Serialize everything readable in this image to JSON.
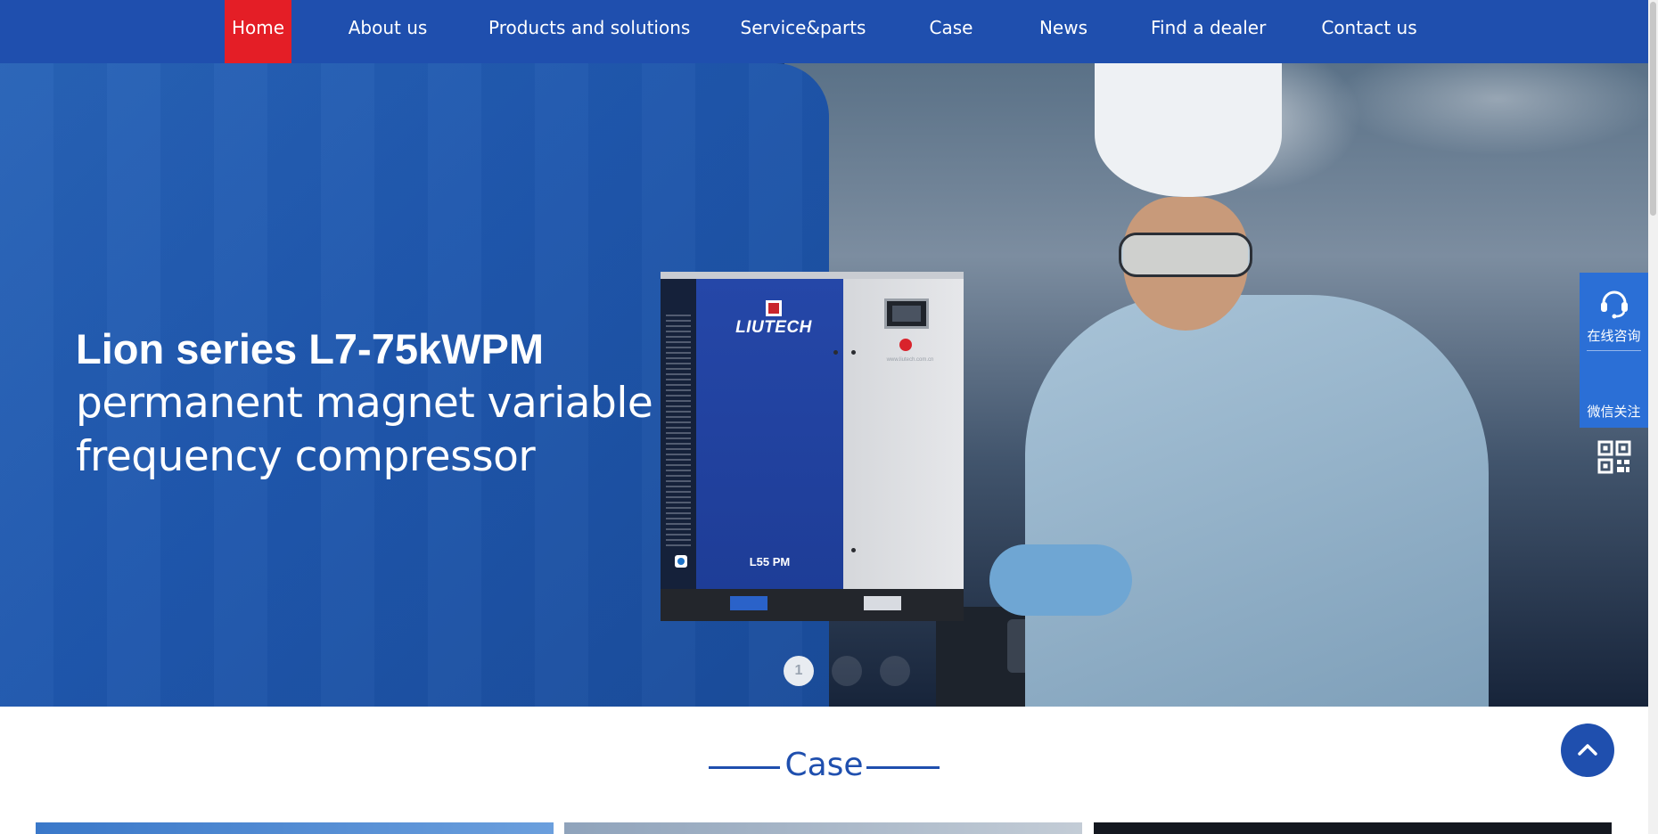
{
  "nav": {
    "items": [
      {
        "label": "Home",
        "active": true
      },
      {
        "label": "About us",
        "active": false
      },
      {
        "label": "Products and solutions",
        "active": false
      },
      {
        "label": "Service&parts",
        "active": false
      },
      {
        "label": "Case",
        "active": false
      },
      {
        "label": "News",
        "active": false
      },
      {
        "label": "Find a dealer",
        "active": false
      },
      {
        "label": "Contact us",
        "active": false
      }
    ]
  },
  "hero": {
    "title_bold": "Lion series L7-75kWPM",
    "title_line2": "permanent magnet variable",
    "title_line3": "frequency compressor",
    "product": {
      "brand": "LIUTECH",
      "model": "L55 PM",
      "website": "www.liutech.com.cn"
    },
    "slider": {
      "current": "1",
      "total_dots": 3
    }
  },
  "side_tools": {
    "consult_label": "在线咨询",
    "wechat_label": "微信关注"
  },
  "case_section": {
    "title": "Case"
  },
  "colors": {
    "nav_bg": "#1f4fae",
    "active_red": "#e41e26",
    "hero_blue": "#2863b7",
    "side_tools_bg": "#2b6fd6"
  }
}
